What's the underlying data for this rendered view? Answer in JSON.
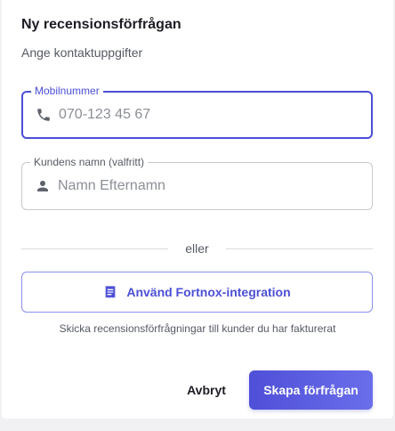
{
  "dialog": {
    "title": "Ny recensionsförfrågan",
    "subtitle": "Ange kontaktuppgifter"
  },
  "phone_field": {
    "label": "Mobilnummer",
    "placeholder": "070-123 45 67",
    "value": "",
    "icon": "phone-icon",
    "focused": true
  },
  "name_field": {
    "label": "Kundens namn (valfritt)",
    "placeholder": "Namn Efternamn",
    "value": "",
    "icon": "person-icon"
  },
  "divider": {
    "text": "eller"
  },
  "fortnox": {
    "label": "Använd Fortnox-integration",
    "icon": "document-icon",
    "helper": "Skicka recensionsförfrågningar till kunder du har fakturerat"
  },
  "actions": {
    "cancel_label": "Avbryt",
    "create_label": "Skapa förfrågan"
  },
  "colors": {
    "accent": "#4b4fd6",
    "button_gradient_start": "#4f4fd8",
    "button_gradient_end": "#6a6eea",
    "border": "#c7c9cf"
  }
}
